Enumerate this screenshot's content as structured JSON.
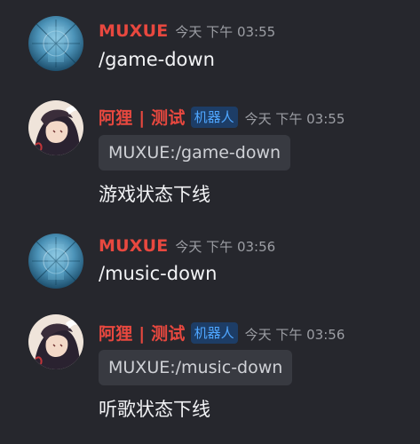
{
  "messages": [
    {
      "author": "MUXUE",
      "timestamp": "今天 下午 03:55",
      "content": "/game-down",
      "avatar_icon": "user-avatar-blue"
    },
    {
      "author": "阿狸 | 测试",
      "badge": "机器人",
      "timestamp": "今天 下午 03:55",
      "reply_snippet": "MUXUE:/game-down",
      "content": "游戏状态下线",
      "avatar_icon": "bot-avatar-anime"
    },
    {
      "author": "MUXUE",
      "timestamp": "今天 下午 03:56",
      "content": "/music-down",
      "avatar_icon": "user-avatar-blue"
    },
    {
      "author": "阿狸 | 测试",
      "badge": "机器人",
      "timestamp": "今天 下午 03:56",
      "reply_snippet": "MUXUE:/music-down",
      "content": "听歌状态下线",
      "avatar_icon": "bot-avatar-anime"
    }
  ],
  "colors": {
    "background": "#26272d",
    "author": "#e8483f",
    "badge_text": "#4fa6ff",
    "badge_bg": "#1d3d66",
    "timestamp": "#9c9ea4",
    "reply_bg": "#383a41"
  }
}
